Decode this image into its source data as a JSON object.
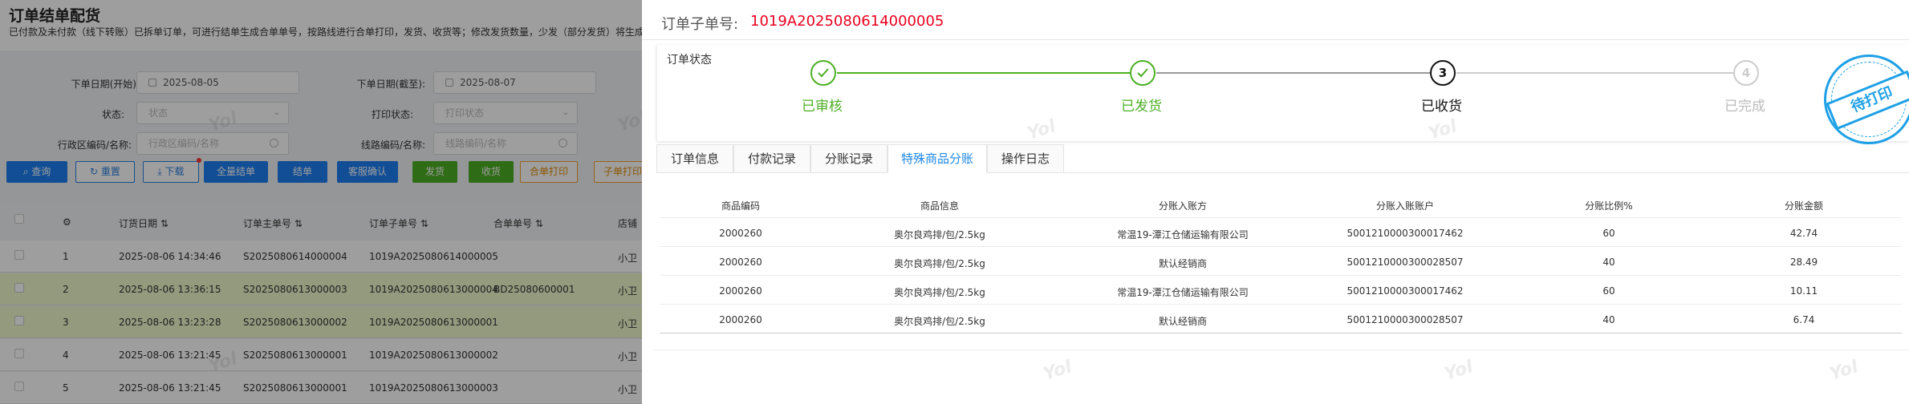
{
  "background": {
    "title": "订单结单配货",
    "description": "已付款及未付款（线下转账）已拆单订单，可进行结单生成合单单号，按路线进行合单打印，发货、收货等；修改发货数量，少发（部分发货）将生成",
    "filters": {
      "order_date_start_label": "下单日期(开始):",
      "order_date_start_value": "2025-08-05",
      "order_date_end_label": "下单日期(截至):",
      "order_date_end_value": "2025-08-07",
      "status_label": "状态:",
      "status_placeholder": "状态",
      "print_status_label": "打印状态:",
      "print_status_placeholder": "打印状态",
      "region_label": "行政区编码/名称:",
      "region_placeholder": "行政区编码/名称",
      "route_label": "线路编码/名称:",
      "route_placeholder": "线路编码/名称"
    },
    "toolbar": {
      "query": "查询",
      "reset": "重置",
      "download": "下载",
      "full_close": "全量结单",
      "close": "结单",
      "cs_confirm": "客服确认",
      "ship": "发货",
      "receive": "收货",
      "merge_print": "合单打印",
      "sub_print": "子单打印"
    },
    "table": {
      "headers": [
        "订货日期",
        "订单主单号",
        "订单子单号",
        "合单单号",
        "店铺"
      ],
      "rows": [
        {
          "idx": "1",
          "date": "2025-08-06 14:34:46",
          "main_no": "S2025080614000004",
          "sub_no": "1019A2025080614000005",
          "merge_no": "",
          "shop": "小卫"
        },
        {
          "idx": "2",
          "date": "2025-08-06 13:36:15",
          "main_no": "S2025080613000003",
          "sub_no": "1019A2025080613000004",
          "merge_no": "BD25080600001",
          "shop": "小卫"
        },
        {
          "idx": "3",
          "date": "2025-08-06 13:23:28",
          "main_no": "S2025080613000002",
          "sub_no": "1019A2025080613000001",
          "merge_no": "",
          "shop": "小卫"
        },
        {
          "idx": "4",
          "date": "2025-08-06 13:21:45",
          "main_no": "S2025080613000001",
          "sub_no": "1019A2025080613000002",
          "merge_no": "",
          "shop": "小卫"
        },
        {
          "idx": "5",
          "date": "2025-08-06 13:21:45",
          "main_no": "S2025080613000001",
          "sub_no": "1019A2025080613000003",
          "merge_no": "",
          "shop": "小卫"
        }
      ]
    },
    "watermark": "Yol"
  },
  "drawer": {
    "sub_order_label": "订单子单号:",
    "sub_order_value": "1019A2025080614000005",
    "status_label": "订单状态",
    "steps": [
      {
        "label": "已审核",
        "number": "1",
        "state": "done"
      },
      {
        "label": "已发货",
        "number": "2",
        "state": "done"
      },
      {
        "label": "已收货",
        "number": "3",
        "state": "current"
      },
      {
        "label": "已完成",
        "number": "4",
        "state": "pending"
      }
    ],
    "stamp": "待打印",
    "tabs": [
      "订单信息",
      "付款记录",
      "分账记录",
      "特殊商品分账",
      "操作日志"
    ],
    "active_tab": 3,
    "table": {
      "headers": [
        "商品编码",
        "商品信息",
        "分账入账方",
        "分账入账账户",
        "分账比例%",
        "分账金额"
      ],
      "rows": [
        [
          "2000260",
          "奥尔良鸡排/包/2.5kg",
          "常温19-潭江仓储运输有限公司",
          "5001210000300017462",
          "60",
          "42.74"
        ],
        [
          "2000260",
          "奥尔良鸡排/包/2.5kg",
          "默认经销商",
          "5001210000300028507",
          "40",
          "28.49"
        ],
        [
          "2000260",
          "奥尔良鸡排/包/2.5kg",
          "常温19-潭江仓储运输有限公司",
          "5001210000300017462",
          "60",
          "10.11"
        ],
        [
          "2000260",
          "奥尔良鸡排/包/2.5kg",
          "默认经销商",
          "5001210000300028507",
          "40",
          "6.74"
        ]
      ]
    }
  },
  "colors": {
    "accent_red": "#e8001e",
    "step_green": "#4caf25",
    "tab_blue": "#1e88e5",
    "stamp_blue": "#1ea0e6"
  }
}
